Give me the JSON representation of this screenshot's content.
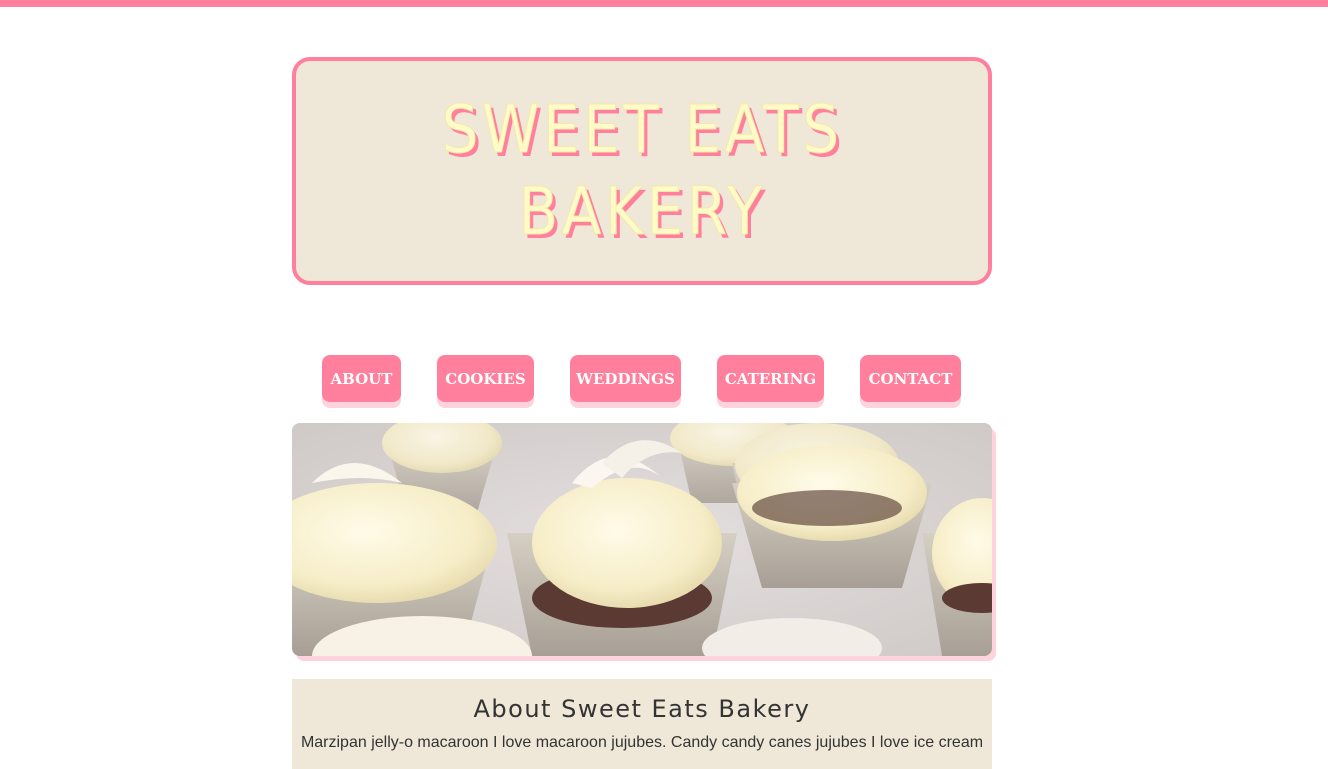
{
  "header": {
    "title": "SWEET EATS BAKERY"
  },
  "nav": {
    "items": [
      {
        "label": "ABOUT"
      },
      {
        "label": "COOKIES"
      },
      {
        "label": "WEDDINGS"
      },
      {
        "label": "CATERING"
      },
      {
        "label": "CONTACT"
      }
    ]
  },
  "hero": {
    "image_subject": "cupcakes with cream frosting"
  },
  "about": {
    "heading": "About Sweet Eats Bakery",
    "body": "Marzipan jelly-o macaroon I love macaroon jujubes. Candy candy canes jujubes I love ice cream"
  },
  "colors": {
    "accent": "#ff7f9c",
    "accent_light": "#ffd3de",
    "cream": "#efe8d8",
    "title_yellow": "#fffbc8"
  }
}
